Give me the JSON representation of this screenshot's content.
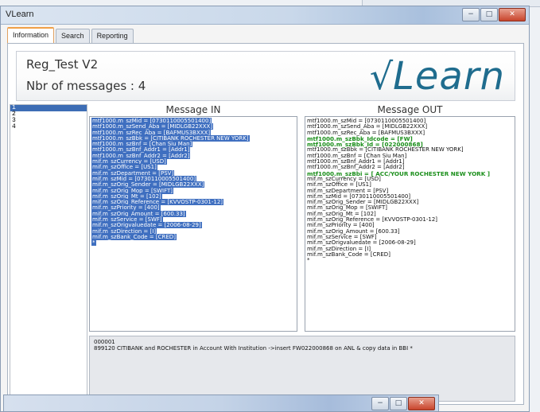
{
  "window": {
    "title": "VLearn"
  },
  "window_controls": {
    "minimize": "−",
    "maximize": "□",
    "close": "✕"
  },
  "tabs": [
    {
      "label": "Information",
      "active": true
    },
    {
      "label": "Search",
      "active": false
    },
    {
      "label": "Reporting",
      "active": false
    }
  ],
  "header": {
    "test_name": "Reg_Test V2",
    "message_count": "Nbr of messages : 4",
    "logo_text": "Learn",
    "logo_mark": "√"
  },
  "message_list": [
    "1",
    "2",
    "3",
    "4"
  ],
  "message_in": {
    "title": "Message IN",
    "lines": [
      "mtf1000.m_szMid = [0730110005501400]",
      "mtf1000.m_szSend_Aba = [MIDLGB22XXX]",
      "mtf1000.m_szRec_Aba = [BAFMUS3BXXX]",
      "mtf1000.m_szBbk = [CITIBANK ROCHESTER NEW YORK]",
      "mtf1000.m_szBnf = [Chan Siu Man]",
      "mtf1000.m_szBnf_Addr1 = [Addr1]",
      "mtf1000.m_szBnf_Addr2 = [Addr2]",
      "mif.m_szCurrency = [USD]",
      "mif.m_szOffice = [US1]",
      "mif.m_szDepartment = [PSV]",
      "mif.m_szMid = [0730110005501400]",
      "mif.m_szOrig_Sender = [MIDLGB22XXX]",
      "mif.m_szOrig_Mop = [SWIFT]",
      "mif.m_szOrig_Mt = [102]",
      "mif.m_szOrig_Reference = [KVVOSTP-0301-12]",
      "mif.m_szPriority = [400]",
      "mif.m_szOrig_Amount = [600.33]",
      "mif.m_szService = [SWF]",
      "mif.m_szOrigvaluedate = [2006-08-29]",
      "mif.m_szDirection = [I]",
      "mif.m_szBank_Code = [CRED]",
      "*"
    ]
  },
  "message_out": {
    "title": "Message OUT",
    "lines": [
      {
        "text": "mtf1000.m_szMid = [0730110005501400]",
        "highlight": false
      },
      {
        "text": "mtf1000.m_szSend_Aba = [MIDLGB22XXX]",
        "highlight": false
      },
      {
        "text": "mtf1000.m_szRec_Aba = [BAFMUS3BXXX]",
        "highlight": false
      },
      {
        "text": "mtf1000.m_szBbk_Idcode = [FW]",
        "highlight": true
      },
      {
        "text": "mtf1000.m_szBbk_Id = [022000868]",
        "highlight": true
      },
      {
        "text": "mtf1000.m_szBbk = [CITIBANK ROCHESTER NEW YORK]",
        "highlight": false
      },
      {
        "text": "mtf1000.m_szBnf = [Chan Siu Man]",
        "highlight": false
      },
      {
        "text": "mtf1000.m_szBnf_Addr1 = [Addr1]",
        "highlight": false
      },
      {
        "text": "mtf1000.m_szBnf_Addr2 = [Addr2]",
        "highlight": false
      },
      {
        "text": "mtf1000.m_szBbi = [ ACC/YOUR ROCHESTER NEW YORK ]",
        "highlight": true
      },
      {
        "text": "mif.m_szCurrency = [USD]",
        "highlight": false
      },
      {
        "text": "mif.m_szOffice = [US1]",
        "highlight": false
      },
      {
        "text": "mif.m_szDepartment = [PSV]",
        "highlight": false
      },
      {
        "text": "mif.m_szMid = [0730110005501400]",
        "highlight": false
      },
      {
        "text": "mif.m_szOrig_Sender = [MIDLGB22XXX]",
        "highlight": false
      },
      {
        "text": "mif.m_szOrig_Mop = [SWIFT]",
        "highlight": false
      },
      {
        "text": "mif.m_szOrig_Mt = [102]",
        "highlight": false
      },
      {
        "text": "mif.m_szOrig_Reference = [KVVOSTP-0301-12]",
        "highlight": false
      },
      {
        "text": "mif.m_szPriority = [400]",
        "highlight": false
      },
      {
        "text": "mif.m_szOrig_Amount = [600.33]",
        "highlight": false
      },
      {
        "text": "mif.m_szService = [SWF]",
        "highlight": false
      },
      {
        "text": "mif.m_szOrigvaluedate = [2006-08-29]",
        "highlight": false
      },
      {
        "text": "mif.m_szDirection = [I]",
        "highlight": false
      },
      {
        "text": "mif.m_szBank_Code = [CRED]",
        "highlight": false
      },
      {
        "text": "*",
        "highlight": false
      }
    ]
  },
  "log": {
    "lines": [
      "000001",
      "899120  CITIBANK and ROCHESTER in Account With Institution ->insert FW022000868 on ANL & copy data in BBI *"
    ]
  },
  "colors": {
    "logo": "#1f6c8e",
    "selection": "#3f6fc0",
    "highlight_green": "#1b8f1b",
    "tab_active_accent": "#f0a048"
  }
}
